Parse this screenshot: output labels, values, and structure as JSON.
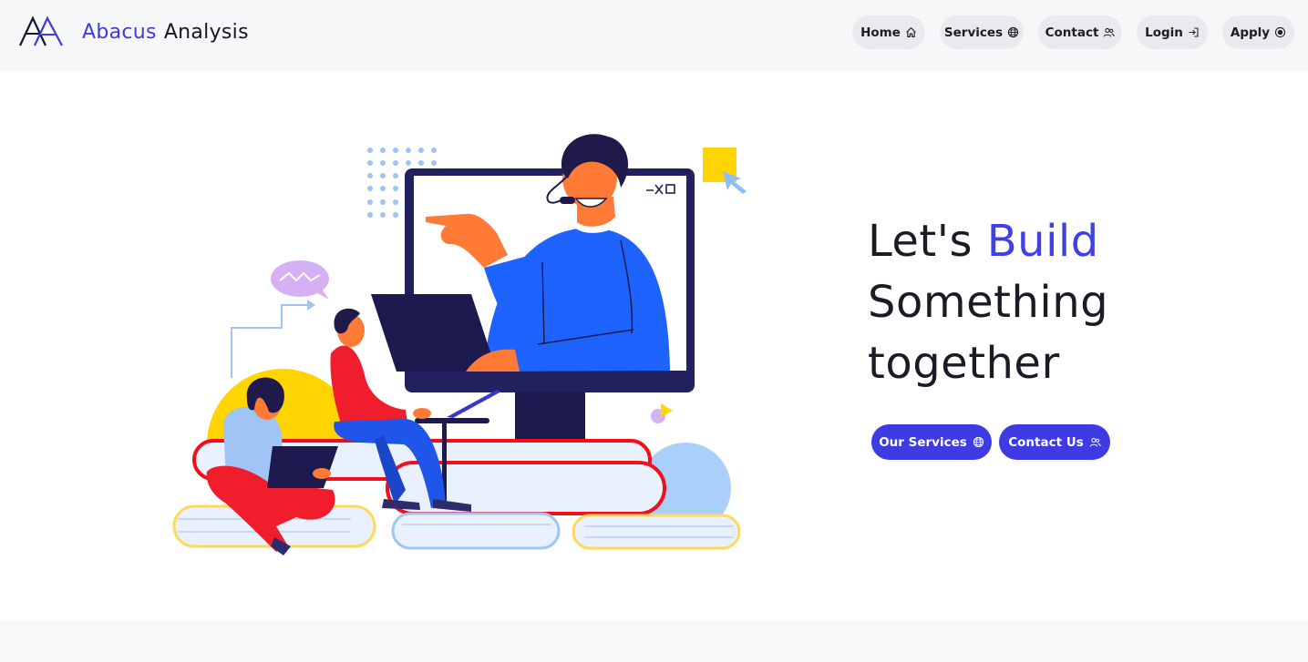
{
  "brand": {
    "name_accent": "Abacus",
    "name_rest": "Analysis",
    "logo_icon": "aa-monogram-logo"
  },
  "nav": {
    "home": {
      "label": "Home",
      "icon": "house-icon"
    },
    "services": {
      "label": "Services",
      "icon": "globe-icon"
    },
    "contact": {
      "label": "Contact",
      "icon": "users-icon"
    },
    "login": {
      "label": "Login",
      "icon": "sign-in-icon"
    },
    "apply": {
      "label": "Apply",
      "icon": "target-icon"
    }
  },
  "hero": {
    "headline_word1": "Let's",
    "headline_accent": "Build",
    "headline_line2": "Something",
    "headline_line3": "together",
    "illustration": "online-learning-illustration"
  },
  "cta": {
    "services": {
      "label": "Our Services",
      "icon": "globe-icon"
    },
    "contact": {
      "label": "Contact Us",
      "icon": "users-icon"
    }
  },
  "colors": {
    "accent": "#3f3be0",
    "nav_bg": "#f6f7f9",
    "button_bg": "#e9eaed",
    "cta_bg": "#3e3be4"
  }
}
